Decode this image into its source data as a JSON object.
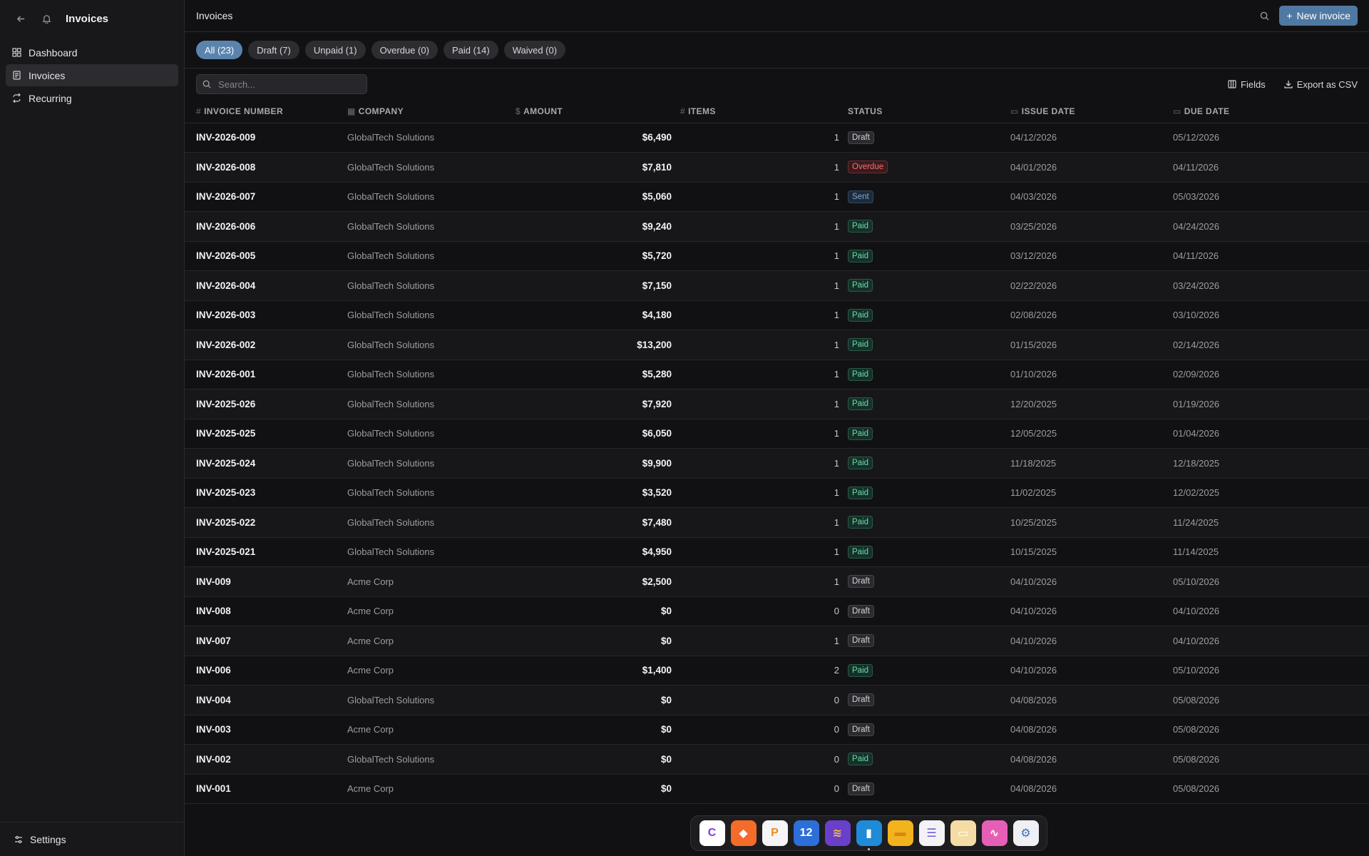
{
  "sidebar": {
    "title": "Invoices",
    "nav": [
      {
        "label": "Dashboard",
        "icon": "dashboard-icon",
        "active": false
      },
      {
        "label": "Invoices",
        "icon": "invoice-icon",
        "active": true
      },
      {
        "label": "Recurring",
        "icon": "repeat-icon",
        "active": false
      }
    ],
    "settings_label": "Settings"
  },
  "topbar": {
    "title": "Invoices",
    "new_button": "New invoice"
  },
  "filters": [
    {
      "label": "All (23)",
      "active": true
    },
    {
      "label": "Draft (7)",
      "active": false
    },
    {
      "label": "Unpaid (1)",
      "active": false
    },
    {
      "label": "Overdue (0)",
      "active": false
    },
    {
      "label": "Paid (14)",
      "active": false
    },
    {
      "label": "Waived (0)",
      "active": false
    }
  ],
  "toolbar": {
    "search_placeholder": "Search...",
    "fields_label": "Fields",
    "export_label": "Export as CSV"
  },
  "table": {
    "headers": {
      "invoice_number": "INVOICE NUMBER",
      "company": "COMPANY",
      "amount": "AMOUNT",
      "items": "ITEMS",
      "status": "STATUS",
      "issue_date": "ISSUE DATE",
      "due_date": "DUE DATE"
    },
    "rows": [
      {
        "invoice": "INV-2026-009",
        "company": "GlobalTech Solutions",
        "amount": "$6,490",
        "items": "1",
        "status": "Draft",
        "issue": "04/12/2026",
        "due": "05/12/2026"
      },
      {
        "invoice": "INV-2026-008",
        "company": "GlobalTech Solutions",
        "amount": "$7,810",
        "items": "1",
        "status": "Overdue",
        "issue": "04/01/2026",
        "due": "04/11/2026"
      },
      {
        "invoice": "INV-2026-007",
        "company": "GlobalTech Solutions",
        "amount": "$5,060",
        "items": "1",
        "status": "Sent",
        "issue": "04/03/2026",
        "due": "05/03/2026"
      },
      {
        "invoice": "INV-2026-006",
        "company": "GlobalTech Solutions",
        "amount": "$9,240",
        "items": "1",
        "status": "Paid",
        "issue": "03/25/2026",
        "due": "04/24/2026"
      },
      {
        "invoice": "INV-2026-005",
        "company": "GlobalTech Solutions",
        "amount": "$5,720",
        "items": "1",
        "status": "Paid",
        "issue": "03/12/2026",
        "due": "04/11/2026"
      },
      {
        "invoice": "INV-2026-004",
        "company": "GlobalTech Solutions",
        "amount": "$7,150",
        "items": "1",
        "status": "Paid",
        "issue": "02/22/2026",
        "due": "03/24/2026"
      },
      {
        "invoice": "INV-2026-003",
        "company": "GlobalTech Solutions",
        "amount": "$4,180",
        "items": "1",
        "status": "Paid",
        "issue": "02/08/2026",
        "due": "03/10/2026"
      },
      {
        "invoice": "INV-2026-002",
        "company": "GlobalTech Solutions",
        "amount": "$13,200",
        "items": "1",
        "status": "Paid",
        "issue": "01/15/2026",
        "due": "02/14/2026"
      },
      {
        "invoice": "INV-2026-001",
        "company": "GlobalTech Solutions",
        "amount": "$5,280",
        "items": "1",
        "status": "Paid",
        "issue": "01/10/2026",
        "due": "02/09/2026"
      },
      {
        "invoice": "INV-2025-026",
        "company": "GlobalTech Solutions",
        "amount": "$7,920",
        "items": "1",
        "status": "Paid",
        "issue": "12/20/2025",
        "due": "01/19/2026"
      },
      {
        "invoice": "INV-2025-025",
        "company": "GlobalTech Solutions",
        "amount": "$6,050",
        "items": "1",
        "status": "Paid",
        "issue": "12/05/2025",
        "due": "01/04/2026"
      },
      {
        "invoice": "INV-2025-024",
        "company": "GlobalTech Solutions",
        "amount": "$9,900",
        "items": "1",
        "status": "Paid",
        "issue": "11/18/2025",
        "due": "12/18/2025"
      },
      {
        "invoice": "INV-2025-023",
        "company": "GlobalTech Solutions",
        "amount": "$3,520",
        "items": "1",
        "status": "Paid",
        "issue": "11/02/2025",
        "due": "12/02/2025"
      },
      {
        "invoice": "INV-2025-022",
        "company": "GlobalTech Solutions",
        "amount": "$7,480",
        "items": "1",
        "status": "Paid",
        "issue": "10/25/2025",
        "due": "11/24/2025"
      },
      {
        "invoice": "INV-2025-021",
        "company": "GlobalTech Solutions",
        "amount": "$4,950",
        "items": "1",
        "status": "Paid",
        "issue": "10/15/2025",
        "due": "11/14/2025"
      },
      {
        "invoice": "INV-009",
        "company": "Acme Corp",
        "amount": "$2,500",
        "items": "1",
        "status": "Draft",
        "issue": "04/10/2026",
        "due": "05/10/2026"
      },
      {
        "invoice": "INV-008",
        "company": "Acme Corp",
        "amount": "$0",
        "items": "0",
        "status": "Draft",
        "issue": "04/10/2026",
        "due": "04/10/2026"
      },
      {
        "invoice": "INV-007",
        "company": "Acme Corp",
        "amount": "$0",
        "items": "1",
        "status": "Draft",
        "issue": "04/10/2026",
        "due": "04/10/2026"
      },
      {
        "invoice": "INV-006",
        "company": "Acme Corp",
        "amount": "$1,400",
        "items": "2",
        "status": "Paid",
        "issue": "04/10/2026",
        "due": "05/10/2026"
      },
      {
        "invoice": "INV-004",
        "company": "GlobalTech Solutions",
        "amount": "$0",
        "items": "0",
        "status": "Draft",
        "issue": "04/08/2026",
        "due": "05/08/2026"
      },
      {
        "invoice": "INV-003",
        "company": "Acme Corp",
        "amount": "$0",
        "items": "0",
        "status": "Draft",
        "issue": "04/08/2026",
        "due": "05/08/2026"
      },
      {
        "invoice": "INV-002",
        "company": "GlobalTech Solutions",
        "amount": "$0",
        "items": "0",
        "status": "Paid",
        "issue": "04/08/2026",
        "due": "05/08/2026"
      },
      {
        "invoice": "INV-001",
        "company": "Acme Corp",
        "amount": "$0",
        "items": "0",
        "status": "Draft",
        "issue": "04/08/2026",
        "due": "05/08/2026"
      }
    ]
  },
  "dock": {
    "apps": [
      {
        "name": "c-app-icon",
        "bg": "#ffffff",
        "fg": "#7b3fe4",
        "glyph": "C"
      },
      {
        "name": "vector-app-icon",
        "bg": "#f46b2a",
        "fg": "#ffffff",
        "glyph": "◆"
      },
      {
        "name": "pages-app-icon",
        "bg": "#f5f5f7",
        "fg": "#f08a1c",
        "glyph": "P"
      },
      {
        "name": "calendar-app-icon",
        "bg": "#2d6fd8",
        "fg": "#ffffff",
        "glyph": "12"
      },
      {
        "name": "wave-app-icon",
        "bg": "#6a3fc9",
        "fg": "#f0c040",
        "glyph": "≋"
      },
      {
        "name": "book-app-icon",
        "bg": "#1f8ad8",
        "fg": "#ffffff",
        "glyph": "▮"
      },
      {
        "name": "folder-app-icon",
        "bg": "#f2b31e",
        "fg": "#d8860f",
        "glyph": "▬"
      },
      {
        "name": "list-app-icon",
        "bg": "#f3f3f6",
        "fg": "#6d5fd6",
        "glyph": "☰"
      },
      {
        "name": "notes-app-icon",
        "bg": "#f4dca4",
        "fg": "#ffffff",
        "glyph": "▭"
      },
      {
        "name": "draw-app-icon",
        "bg": "#e65fb6",
        "fg": "#ffffff",
        "glyph": "∿"
      },
      {
        "name": "settings-app-icon",
        "bg": "#eef0f4",
        "fg": "#3e6fc2",
        "glyph": "⚙"
      }
    ],
    "active_index": 5
  }
}
